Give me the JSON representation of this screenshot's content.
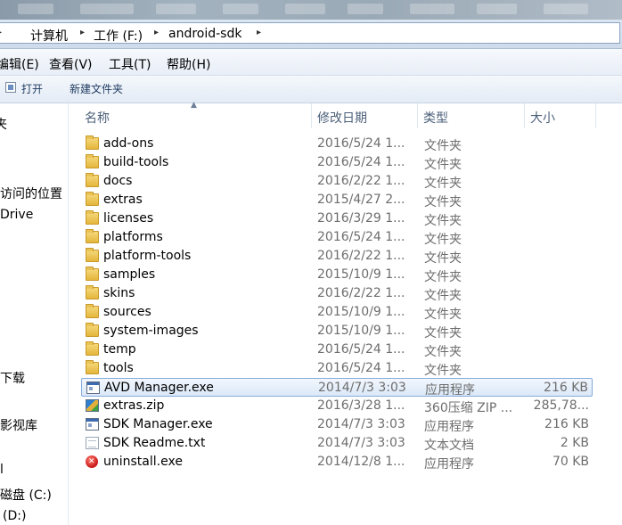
{
  "address_bar": {
    "crumbs": [
      "计算机",
      "工作 (F:)",
      "android-sdk"
    ]
  },
  "menu": {
    "items": [
      "编辑(E)",
      "查看(V)",
      "工具(T)",
      "帮助(H)"
    ]
  },
  "toolbar": {
    "open_label": "打开",
    "new_folder_label": "新建文件夹"
  },
  "nav": {
    "items": [
      "夹",
      "访问的位置",
      "Drive",
      "下载",
      "影视库",
      "l",
      "磁盘 (C:)",
      "(D:)"
    ]
  },
  "columns": {
    "name": "名称",
    "date": "修改日期",
    "type": "类型",
    "size": "大小"
  },
  "files": [
    {
      "name": "add-ons",
      "date": "2016/5/24 1...",
      "type": "文件夹",
      "size": "",
      "icon": "folder-icon"
    },
    {
      "name": "build-tools",
      "date": "2016/5/24 1...",
      "type": "文件夹",
      "size": "",
      "icon": "folder-icon"
    },
    {
      "name": "docs",
      "date": "2016/2/22 1...",
      "type": "文件夹",
      "size": "",
      "icon": "folder-icon"
    },
    {
      "name": "extras",
      "date": "2015/4/27 2...",
      "type": "文件夹",
      "size": "",
      "icon": "folder-icon"
    },
    {
      "name": "licenses",
      "date": "2016/3/29 1...",
      "type": "文件夹",
      "size": "",
      "icon": "folder-icon"
    },
    {
      "name": "platforms",
      "date": "2016/5/24 1...",
      "type": "文件夹",
      "size": "",
      "icon": "folder-icon"
    },
    {
      "name": "platform-tools",
      "date": "2016/2/22 1...",
      "type": "文件夹",
      "size": "",
      "icon": "folder-icon"
    },
    {
      "name": "samples",
      "date": "2015/10/9 1...",
      "type": "文件夹",
      "size": "",
      "icon": "folder-icon"
    },
    {
      "name": "skins",
      "date": "2016/2/22 1...",
      "type": "文件夹",
      "size": "",
      "icon": "folder-icon"
    },
    {
      "name": "sources",
      "date": "2015/10/9 1...",
      "type": "文件夹",
      "size": "",
      "icon": "folder-icon"
    },
    {
      "name": "system-images",
      "date": "2015/10/9 1...",
      "type": "文件夹",
      "size": "",
      "icon": "folder-icon"
    },
    {
      "name": "temp",
      "date": "2016/5/24 1...",
      "type": "文件夹",
      "size": "",
      "icon": "folder-icon"
    },
    {
      "name": "tools",
      "date": "2016/5/24 1...",
      "type": "文件夹",
      "size": "",
      "icon": "folder-icon"
    },
    {
      "name": "AVD Manager.exe",
      "date": "2014/7/3 3:03",
      "type": "应用程序",
      "size": "216 KB",
      "icon": "exe-icon",
      "selected": true
    },
    {
      "name": "extras.zip",
      "date": "2016/3/28 1...",
      "type": "360压缩 ZIP ...",
      "size": "285,78...",
      "icon": "zip-icon"
    },
    {
      "name": "SDK Manager.exe",
      "date": "2014/7/3 3:03",
      "type": "应用程序",
      "size": "216 KB",
      "icon": "exe-icon"
    },
    {
      "name": "SDK Readme.txt",
      "date": "2014/7/3 3:03",
      "type": "文本文档",
      "size": "2 KB",
      "icon": "txt-icon"
    },
    {
      "name": "uninstall.exe",
      "date": "2014/12/8 1...",
      "type": "应用程序",
      "size": "70 KB",
      "icon": "uninstall-icon"
    }
  ]
}
